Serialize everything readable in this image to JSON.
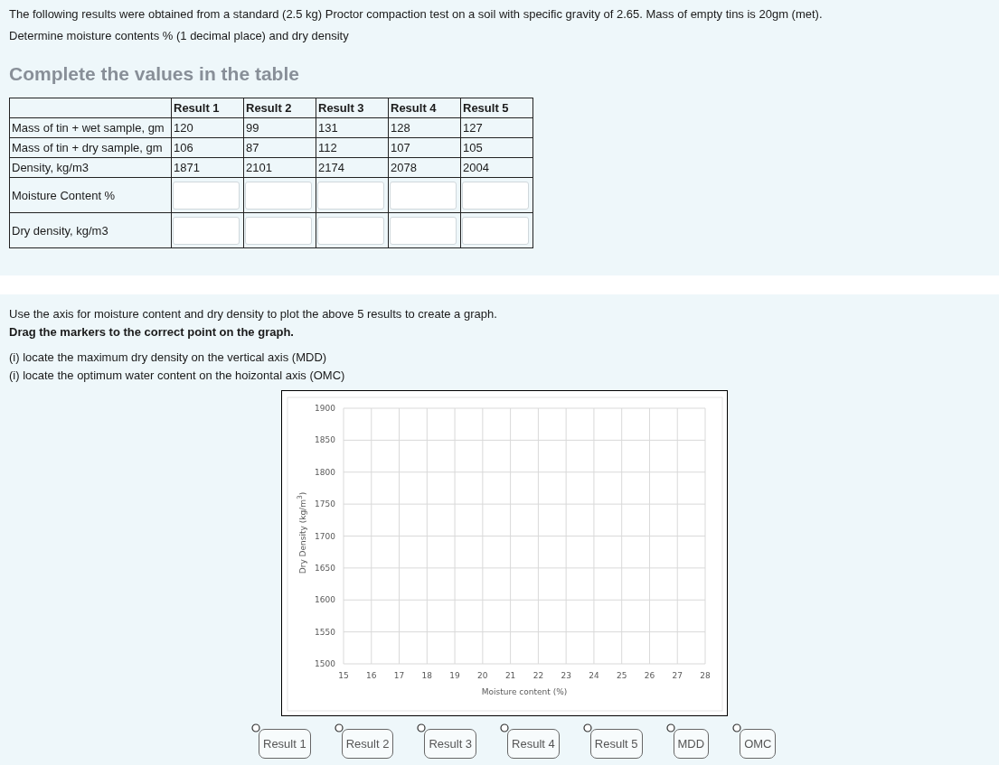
{
  "intro": [
    "The following results were obtained from a standard (2.5 kg) Proctor compaction test on a soil with specific gravity of 2.65. Mass of empty tins is 20gm (met).",
    "Determine moisture contents % (1 decimal place) and dry density"
  ],
  "heading": "Complete the values in the table",
  "table": {
    "columns": [
      "Result 1",
      "Result 2",
      "Result 3",
      "Result 4",
      "Result 5"
    ],
    "rows": [
      {
        "label": "Mass of tin + wet sample, gm",
        "kind": "value",
        "cells": [
          "120",
          "99",
          "131",
          "128",
          "127"
        ]
      },
      {
        "label": "Mass of tin + dry sample, gm",
        "kind": "value",
        "cells": [
          "106",
          "87",
          "112",
          "107",
          "105"
        ]
      },
      {
        "label": "Density, kg/m3",
        "kind": "value",
        "cells": [
          "1871",
          "2101",
          "2174",
          "2078",
          "2004"
        ]
      },
      {
        "label": "Moisture Content %",
        "kind": "input"
      },
      {
        "label": "Dry density, kg/m3",
        "kind": "input"
      }
    ]
  },
  "instructions": {
    "text": "Use the axis for moisture content and dry density to plot the above 5 results to create a graph.",
    "bold_text": "Drag the markers to the correct point on the graph.",
    "steps": [
      "(i) locate the maximum dry density on the vertical axis (MDD)",
      "(i) locate the optimum water content on the hoizontal axis (OMC)"
    ]
  },
  "chart": {
    "chart_data": {
      "type": "scatter",
      "grid": true,
      "xlabel": "Moisture content (%)",
      "ylabel": "Dry Density (kg/m$^{3}$)",
      "xlim": [
        15,
        28
      ],
      "ylim": [
        1500,
        1900
      ],
      "xticks": [
        15,
        16,
        17,
        18,
        19,
        20,
        21,
        22,
        23,
        24,
        25,
        26,
        27,
        28
      ],
      "yticks": [
        1500,
        1550,
        1600,
        1650,
        1700,
        1750,
        1800,
        1850,
        1900
      ]
    }
  },
  "markers": [
    "Result 1",
    "Result 2",
    "Result 3",
    "Result 4",
    "Result 5",
    "MDD",
    "OMC"
  ]
}
